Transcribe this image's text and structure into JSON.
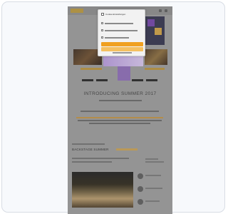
{
  "page": {
    "title": "INTRODUCING SUMMER 2017"
  },
  "modal": {
    "title": "Cookie-Einstellungen",
    "rows": [
      {
        "checked": false
      },
      {
        "checked": false
      },
      {
        "checked": false
      }
    ],
    "buttons": [
      {
        "kind": "primary"
      },
      {
        "kind": "secondary"
      }
    ]
  },
  "section": {
    "title": "BACKSTAGE SUMMER"
  },
  "colors": {
    "accent": "#f0a020",
    "gold": "#c09040",
    "purple": "#8b6ab8"
  }
}
